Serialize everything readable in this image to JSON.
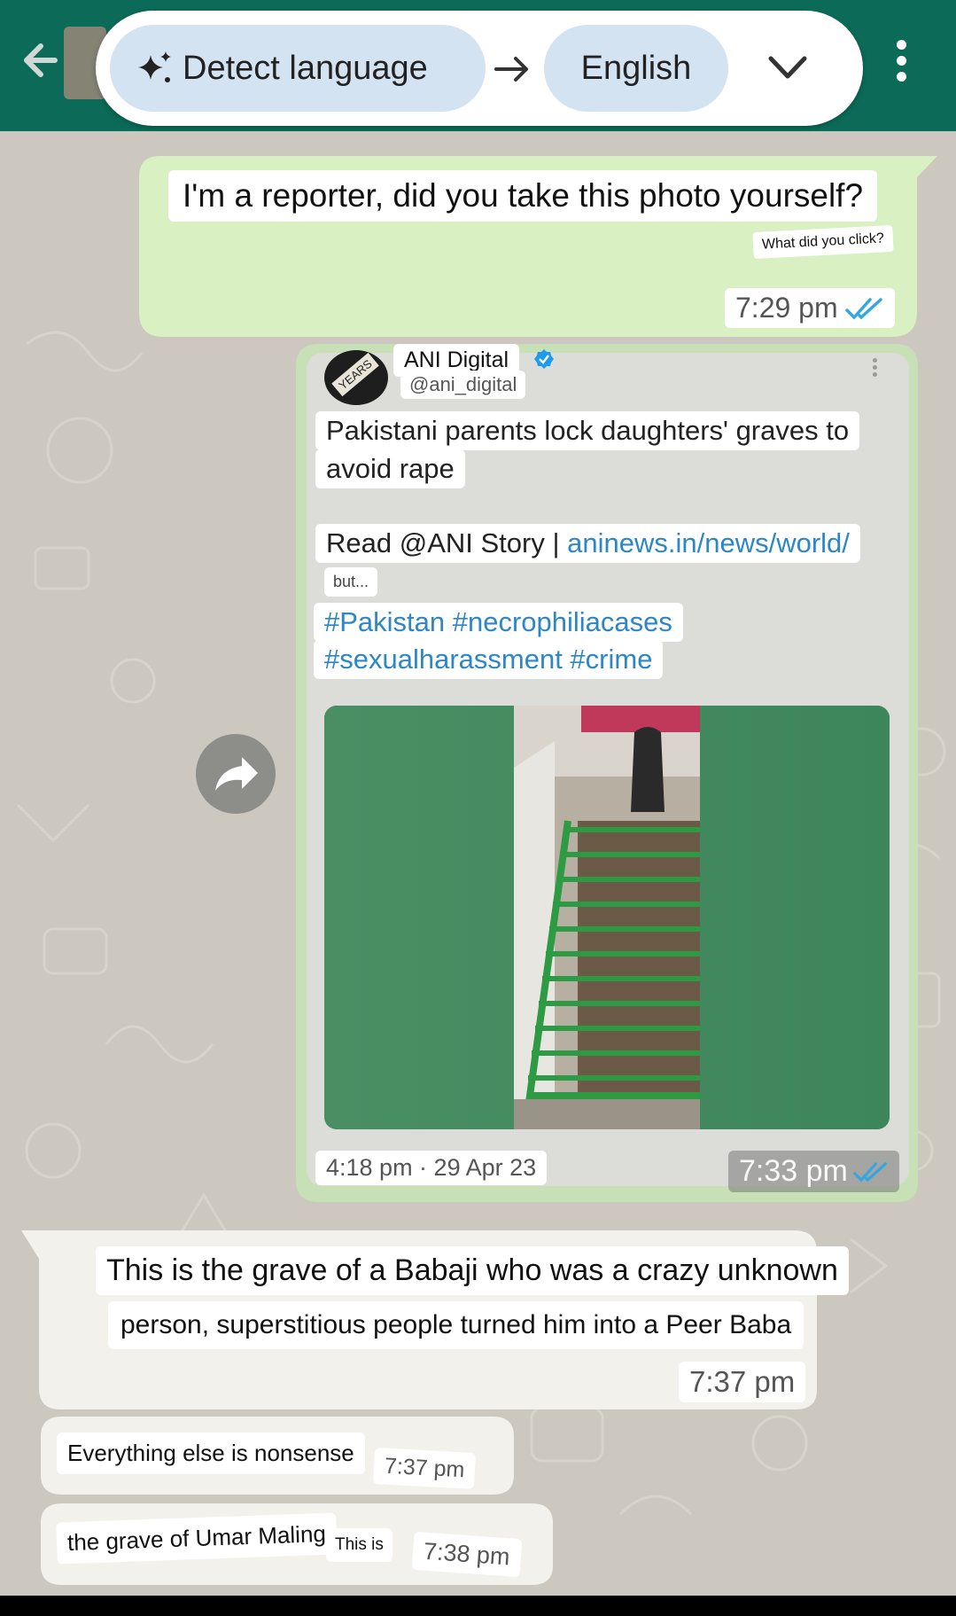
{
  "translate_bar": {
    "source_language": "Detect language",
    "target_language": "English"
  },
  "messages": {
    "m1": {
      "text": "I'm a reporter, did you take this photo yourself?",
      "original": "What did you click?",
      "time": "7:29 pm"
    },
    "tweet": {
      "account_name": "ANI Digital",
      "handle": "@ani_digital",
      "logo_text": "YEARS",
      "headline_line1": "Pakistani parents lock daughters' graves to",
      "headline_line2": "avoid rape",
      "read_prefix": "Read @ANI Story | ",
      "link": "aninews.in/news/world/",
      "truncated": "but...",
      "hashtags_line1": "#Pakistan #necrophiliacases",
      "hashtags_line2": "#sexualharassment #crime",
      "posted": "4:18 pm · 29 Apr 23",
      "time": "7:33 pm"
    },
    "m3": {
      "line1": "This is the grave of a Babaji who was a crazy unknown",
      "line2": "person, superstitious people turned him into a Peer Baba",
      "time": "7:37 pm"
    },
    "m4": {
      "text": "Everything else is nonsense",
      "time": "7:37 pm"
    },
    "m5": {
      "text": "the grave of Umar Maling",
      "fragment": "This is",
      "time": "7:38 pm"
    }
  },
  "colors": {
    "header": "#0b6b58",
    "outgoing_bubble": "#d9f0c2",
    "incoming_bubble": "#f3f1ec",
    "read_ticks": "#34a7e0",
    "link": "#2c86c8",
    "chat_background": "#ccc8c0"
  },
  "icons": [
    "back-arrow-icon",
    "sparkle-icon",
    "arrow-right-icon",
    "chevron-down-icon",
    "more-vert-icon",
    "verified-badge-icon",
    "forward-icon",
    "double-tick-icon"
  ]
}
